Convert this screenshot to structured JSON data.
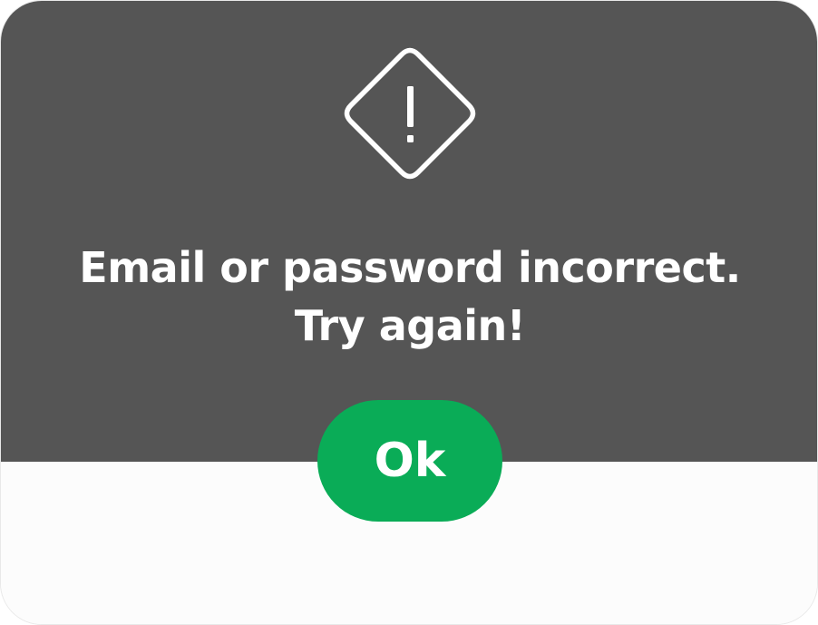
{
  "dialog": {
    "message_line1": "Email or password incorrect.",
    "message_line2": "Try again!",
    "icon": "warning-diamond-icon",
    "ok_label": "Ok"
  },
  "colors": {
    "top_background": "#555555",
    "bottom_background": "#fcfcfc",
    "button": "#0aac57",
    "text": "#ffffff"
  }
}
